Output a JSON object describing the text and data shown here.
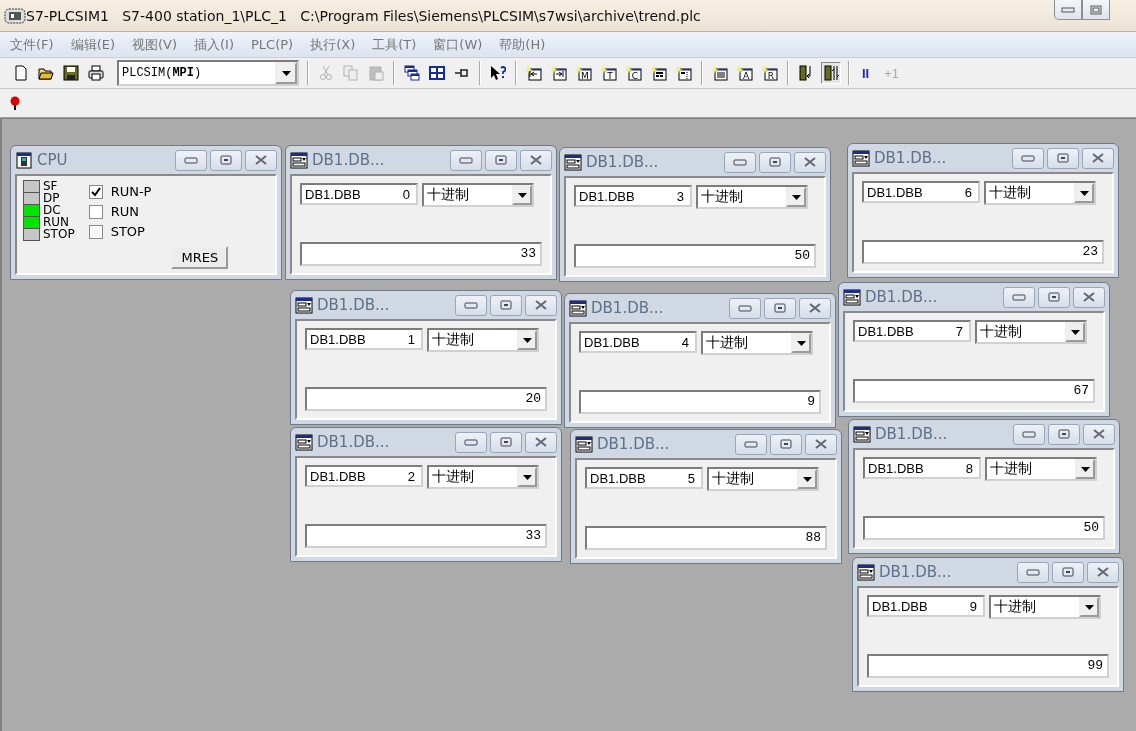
{
  "window": {
    "title": "S7-PLCSIM1   S7-400 station_1\\PLC_1   C:\\Program Files\\Siemens\\PLCSIM\\s7wsi\\archive\\trend.plc"
  },
  "menu": [
    "文件(F)",
    "编辑(E)",
    "视图(V)",
    "插入(I)",
    "PLC(P)",
    "执行(X)",
    "工具(T)",
    "窗口(W)",
    "帮助(H)"
  ],
  "toolbar": {
    "file_buttons": [
      {
        "kind": "new"
      },
      {
        "kind": "open"
      },
      {
        "kind": "save"
      },
      {
        "kind": "print"
      }
    ],
    "connection": "PLCSIM(**MPI**)",
    "edit_buttons": [
      {
        "kind": "cut",
        "disabled": true
      },
      {
        "kind": "copy",
        "disabled": true
      },
      {
        "kind": "paste",
        "disabled": true
      }
    ],
    "window_buttons": [
      {
        "kind": "cascade"
      },
      {
        "kind": "tile"
      },
      {
        "kind": "pin"
      }
    ],
    "help_buttons": [
      {
        "kind": "help"
      }
    ],
    "insert_buttons": [
      {
        "kind": "input"
      },
      {
        "kind": "output"
      },
      {
        "kind": "letter",
        "glyph": "M"
      },
      {
        "kind": "letter",
        "glyph": "T"
      },
      {
        "kind": "letter",
        "glyph": "C"
      },
      {
        "kind": "var"
      },
      {
        "kind": "vertical"
      },
      {
        "kind": "stack"
      },
      {
        "kind": "letter",
        "glyph": "A"
      },
      {
        "kind": "letter",
        "glyph": "R"
      }
    ],
    "mode_buttons": [
      {
        "kind": "single",
        "pressed": false
      },
      {
        "kind": "cycle",
        "pressed": true
      }
    ],
    "run_buttons": [
      {
        "label": "II",
        "disabled": false
      },
      {
        "label": "+1",
        "disabled": true
      }
    ]
  },
  "toolbar_2": [
    {
      "kind": "breakpoint"
    }
  ],
  "cpu": {
    "title": "CPU",
    "leds": [
      {
        "label": "SF",
        "on": false
      },
      {
        "label": "DP",
        "on": false
      },
      {
        "label": "DC",
        "on": true
      },
      {
        "label": "RUN",
        "on": true
      },
      {
        "label": "STOP",
        "on": false
      }
    ],
    "modes": [
      {
        "label": "RUN-P",
        "checked": true
      },
      {
        "label": "RUN",
        "checked": false
      },
      {
        "label": "STOP",
        "checked": false
      }
    ],
    "mres_button": "MRES"
  },
  "monitors": [
    {
      "title": "DB1.DB...",
      "address": "DB1.DBB",
      "byte": "0",
      "format": "十进制",
      "value": "33"
    },
    {
      "title": "DB1.DB...",
      "address": "DB1.DBB",
      "byte": "3",
      "format": "十进制",
      "value": "50"
    },
    {
      "title": "DB1.DB...",
      "address": "DB1.DBB",
      "byte": "6",
      "format": "十进制",
      "value": "23"
    },
    {
      "title": "DB1.DB...",
      "address": "DB1.DBB",
      "byte": "1",
      "format": "十进制",
      "value": "20"
    },
    {
      "title": "DB1.DB...",
      "address": "DB1.DBB",
      "byte": "4",
      "format": "十进制",
      "value": "9"
    },
    {
      "title": "DB1.DB...",
      "address": "DB1.DBB",
      "byte": "7",
      "format": "十进制",
      "value": "67"
    },
    {
      "title": "DB1.DB...",
      "address": "DB1.DBB",
      "byte": "2",
      "format": "十进制",
      "value": "33"
    },
    {
      "title": "DB1.DB...",
      "address": "DB1.DBB",
      "byte": "5",
      "format": "十进制",
      "value": "88"
    },
    {
      "title": "DB1.DB...",
      "address": "DB1.DBB",
      "byte": "8",
      "format": "十进制",
      "value": "50"
    },
    {
      "title": "DB1.DB...",
      "address": "DB1.DBB",
      "byte": "9",
      "format": "十进制",
      "value": "99"
    }
  ]
}
